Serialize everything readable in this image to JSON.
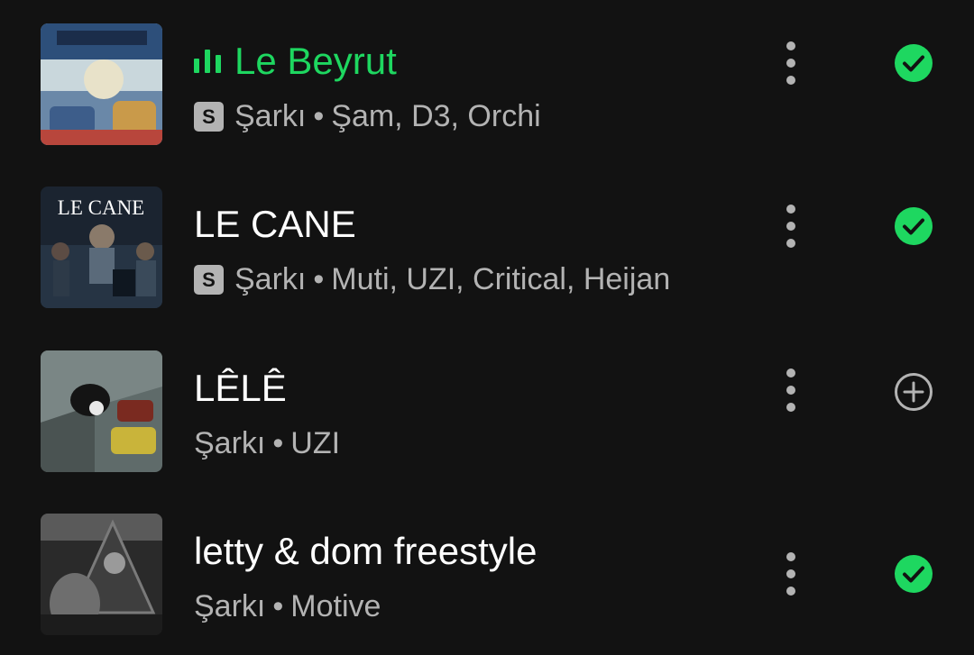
{
  "colors": {
    "background": "#121212",
    "accent": "#1ed760",
    "secondary_text": "#b3b3b3"
  },
  "tracks": [
    {
      "title": "Le Beyrut",
      "playing": true,
      "badge": "S",
      "type": "Şarkı",
      "separator": "•",
      "artists": "Şam, D3, Orchi",
      "status_icon": "check-circle-icon",
      "in_library": true,
      "art_text": ""
    },
    {
      "title": "LE CANE",
      "playing": false,
      "badge": "S",
      "type": "Şarkı",
      "separator": "•",
      "artists": "Muti, UZI, Critical, Heijan",
      "status_icon": "check-circle-icon",
      "in_library": true,
      "art_text": "LE CANE"
    },
    {
      "title": "LÊLÊ",
      "playing": false,
      "badge": "",
      "type": "Şarkı",
      "separator": "•",
      "artists": "UZI",
      "status_icon": "add-circle-icon",
      "in_library": false,
      "art_text": ""
    },
    {
      "title": "letty & dom freestyle",
      "playing": false,
      "badge": "",
      "type": "Şarkı",
      "separator": "•",
      "artists": "Motive",
      "status_icon": "check-circle-icon",
      "in_library": true,
      "art_text": ""
    }
  ]
}
